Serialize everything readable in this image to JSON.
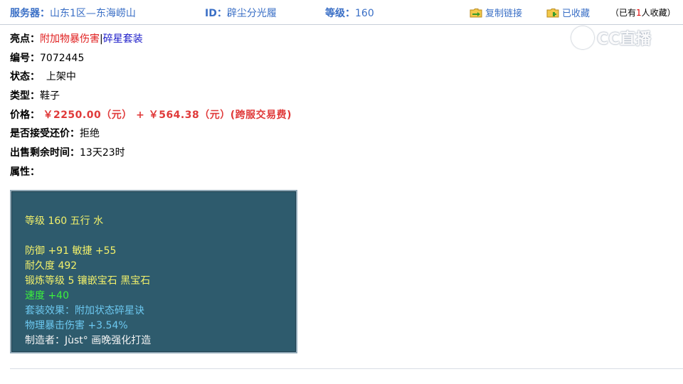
{
  "header": {
    "server_label": "服务器：",
    "server_value": "山东1区—东海崂山",
    "id_label": "ID：",
    "id_value": "辟尘分光履",
    "level_label": "等级：",
    "level_value": "160",
    "copy_link": "复制链接",
    "favorited": "已收藏",
    "count_prefix": "（已有",
    "count_num": "1",
    "count_suffix": "人收藏）"
  },
  "watermark": {
    "text": "CC直播"
  },
  "info": {
    "highlight_label": "亮点：",
    "highlight_1": "附加物暴伤害",
    "highlight_sep": "|",
    "highlight_2": "碎星套装",
    "number_label": "编号：",
    "number_value": "7072445",
    "status_label": "状态：",
    "status_value": "上架中",
    "type_label": "类型：",
    "type_value": "鞋子",
    "price_label": "价格：",
    "price_value": "￥2250.00（元） + ￥564.38（元）(跨服交易费)",
    "bargain_label": "是否接受还价：",
    "bargain_value": "拒绝",
    "time_label": "出售剩余时间：",
    "time_value": "13天23时",
    "attr_label": "属性："
  },
  "attributes": {
    "line1": "等级 160 五行 水",
    "line2": "防御 +91 敏捷 +55",
    "line3": "耐久度 492",
    "line4": "锻炼等级 5 镶嵌宝石 黑宝石",
    "line5": "速度 +40",
    "line6": "套装效果：附加状态碎星诀",
    "line7": "物理暴击伤害 +3.54%",
    "line8": "制造者：Jùst° 画晚强化打造"
  },
  "colors": {
    "link_blue": "#3a6fc6",
    "red": "#e02020",
    "attr_bg": "#2e5b6d",
    "attr_yellow": "#f2f06a",
    "attr_green": "#3cf23c",
    "attr_cyan": "#6cc8f0"
  },
  "icons": [
    "folder-copy-icon",
    "folder-fav-icon",
    "cc-logo-icon"
  ]
}
